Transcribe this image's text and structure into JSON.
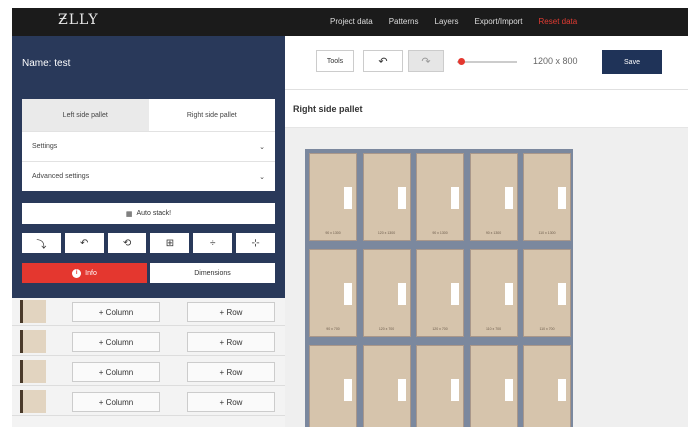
{
  "app": {
    "logo": "ƵLLY"
  },
  "nav": {
    "items": [
      "Project data",
      "Patterns",
      "Layers",
      "Export/Import",
      "Reset data"
    ],
    "active_index": 4
  },
  "left": {
    "name_label": "Name: test",
    "tabs": [
      "Left side pallet",
      "Right side pallet"
    ],
    "settings": "Settings",
    "advanced": "Advanced settings",
    "auto_stack": "Auto stack!",
    "tool_icons": [
      "rotate-icon",
      "undo-icon",
      "reset-icon",
      "grid-icon",
      "align-vertical-icon",
      "align-horizontal-icon"
    ],
    "info_label": "Info",
    "dimensions_label": "Dimensions",
    "rows": [
      {
        "column_label": "+ Column",
        "row_label": "+ Row"
      },
      {
        "column_label": "+ Column",
        "row_label": "+ Row"
      },
      {
        "column_label": "+ Column",
        "row_label": "+ Row"
      },
      {
        "column_label": "+ Column",
        "row_label": "+ Row"
      }
    ]
  },
  "toolbar": {
    "tools_label": "Tools",
    "size": "1200 x 800",
    "save_label": "Save",
    "zoom_level": 0.05
  },
  "right": {
    "title": "Right side pallet",
    "cell_labels": [
      [
        "90 x 1300",
        "120 x 1300",
        "90 x 1300",
        "90 x 1300",
        "110 x 1300"
      ],
      [
        "90 x 700",
        "120 x 700",
        "120 x 700",
        "110 x 700",
        "110 x 700"
      ],
      [
        "",
        "",
        "",
        "",
        ""
      ]
    ]
  },
  "colors": {
    "accent": "#e4372f",
    "navy": "#29395a",
    "save": "#1f3358",
    "box": "#d6c4ac"
  }
}
